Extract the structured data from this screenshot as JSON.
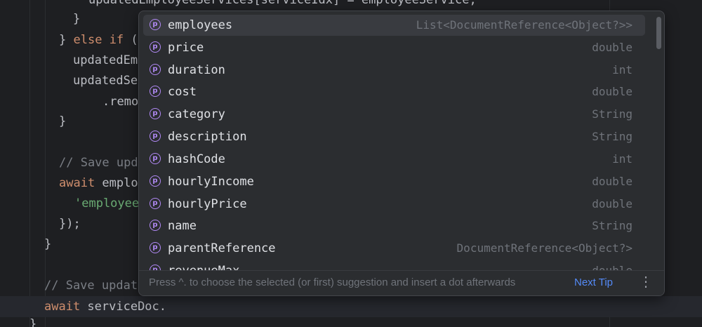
{
  "editor": {
    "lines": {
      "l0": "updatedEmployeeServices[serviceIdx] = employeeService;",
      "l1": "}",
      "l2_close": "} ",
      "l2_kw1": "else",
      "l2_kw2": "if",
      "l2_rest": " (",
      "l3": "updatedEm",
      "l4": "updatedSe",
      "l5": ".remo",
      "l6": "}",
      "l7": "// Save upd",
      "l8_kw": "await",
      "l8_rest": " emplo",
      "l9": "'employee",
      "l10": "});",
      "l11": "}",
      "l12": "// Save updat",
      "l13_kw": "await",
      "l13_rest": " serviceDoc.",
      "l14": "}"
    }
  },
  "completion": {
    "items": [
      {
        "icon": "property-icon",
        "badge": "p",
        "name": "employees",
        "type": "List<DocumentReference<Object?>>",
        "selected": true
      },
      {
        "icon": "property-icon",
        "badge": "p",
        "name": "price",
        "type": "double"
      },
      {
        "icon": "property-icon",
        "badge": "p",
        "name": "duration",
        "type": "int"
      },
      {
        "icon": "property-icon",
        "badge": "p",
        "name": "cost",
        "type": "double"
      },
      {
        "icon": "property-icon",
        "badge": "p",
        "name": "category",
        "type": "String"
      },
      {
        "icon": "property-icon",
        "badge": "p",
        "name": "description",
        "type": "String"
      },
      {
        "icon": "property-icon",
        "badge": "p",
        "name": "hashCode",
        "type": "int"
      },
      {
        "icon": "property-icon",
        "badge": "p",
        "name": "hourlyIncome",
        "type": "double"
      },
      {
        "icon": "property-icon",
        "badge": "p",
        "name": "hourlyPrice",
        "type": "double"
      },
      {
        "icon": "property-icon",
        "badge": "p",
        "name": "name",
        "type": "String"
      },
      {
        "icon": "property-icon",
        "badge": "p",
        "name": "parentReference",
        "type": "DocumentReference<Object?>"
      },
      {
        "icon": "property-icon",
        "badge": "p",
        "name": "revenueMax",
        "type": "double"
      }
    ],
    "footer": {
      "hint": "Press ^. to choose the selected (or first) suggestion and insert a dot afterwards",
      "next_tip": "Next Tip",
      "more_icon": "more-vertical-icon",
      "more_glyph": "⋮"
    }
  },
  "colors": {
    "background": "#1e1f22",
    "keyword": "#cf8e6d",
    "comment": "#7a7e85",
    "string": "#6aab73",
    "property_icon": "#b189f5",
    "link": "#548af7"
  }
}
